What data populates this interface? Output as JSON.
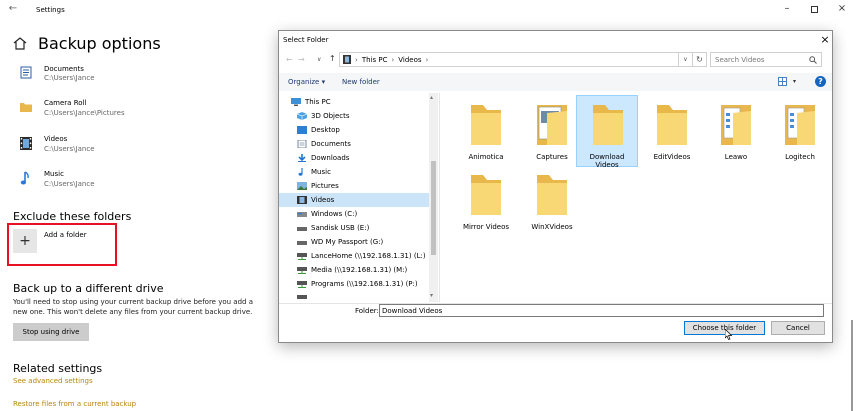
{
  "settings": {
    "window_title": "Settings",
    "page_title": "Backup options",
    "folders": [
      {
        "label": "Documents",
        "path": "C:\\Users\\Jance"
      },
      {
        "label": "Camera Roll",
        "path": "C:\\Users\\Jance\\Pictures"
      },
      {
        "label": "Videos",
        "path": "C:\\Users\\Jance"
      },
      {
        "label": "Music",
        "path": "C:\\Users\\Jance"
      }
    ],
    "exclude": {
      "title": "Exclude these folders",
      "add_label": "Add a folder"
    },
    "drive": {
      "title": "Back up to a different drive",
      "desc_line1": "You'll need to stop using your current backup drive before you add a",
      "desc_line2": "new one. This won't delete any files from your current backup drive.",
      "stop_button": "Stop using drive"
    },
    "related": {
      "title": "Related settings",
      "advanced_link": "See advanced settings",
      "restore_link": "Restore files from a current backup"
    },
    "highlight_color": "#e81123"
  },
  "dialog": {
    "title": "Select Folder",
    "close_glyph": "×",
    "breadcrumb": {
      "root": "This PC",
      "current": "Videos"
    },
    "search_placeholder": "Search Videos",
    "toolbar": {
      "organize": "Organize ▾",
      "new_folder": "New folder",
      "help_glyph": "?"
    },
    "nav": [
      {
        "label": "This PC",
        "icon": "computer-icon"
      },
      {
        "label": "3D Objects",
        "icon": "cube-icon"
      },
      {
        "label": "Desktop",
        "icon": "desktop-icon"
      },
      {
        "label": "Documents",
        "icon": "document-icon"
      },
      {
        "label": "Downloads",
        "icon": "download-icon"
      },
      {
        "label": "Music",
        "icon": "music-icon"
      },
      {
        "label": "Pictures",
        "icon": "picture-icon"
      },
      {
        "label": "Videos",
        "icon": "video-icon",
        "selected": true
      },
      {
        "label": "Windows (C:)",
        "icon": "drive-icon"
      },
      {
        "label": "Sandisk USB (E:)",
        "icon": "usb-drive-icon"
      },
      {
        "label": "WD My Passport (G:)",
        "icon": "usb-drive-icon"
      },
      {
        "label": "LanceHome (\\\\192.168.1.31) (L:)",
        "icon": "network-drive-icon"
      },
      {
        "label": "Media (\\\\192.168.1.31) (M:)",
        "icon": "network-drive-icon"
      },
      {
        "label": "Programs (\\\\192.168.1.31) (P:)",
        "icon": "network-drive-icon"
      }
    ],
    "folders": [
      {
        "label": "Animotica",
        "variant": "plain"
      },
      {
        "label": "Captures",
        "variant": "open"
      },
      {
        "label": "Download Videos",
        "variant": "plain",
        "selected": true
      },
      {
        "label": "EditVideos",
        "variant": "plain"
      },
      {
        "label": "Leawo",
        "variant": "docs"
      },
      {
        "label": "Logitech",
        "variant": "docs"
      },
      {
        "label": "Mirror Videos",
        "variant": "plain"
      },
      {
        "label": "WinXVideos",
        "variant": "plain"
      }
    ],
    "folder_field_label": "Folder:",
    "folder_field_value": "Download Videos",
    "choose_button": "Choose this folder",
    "cancel_button": "Cancel",
    "accent": "#0078d7",
    "folder_color": "#f8d775"
  }
}
